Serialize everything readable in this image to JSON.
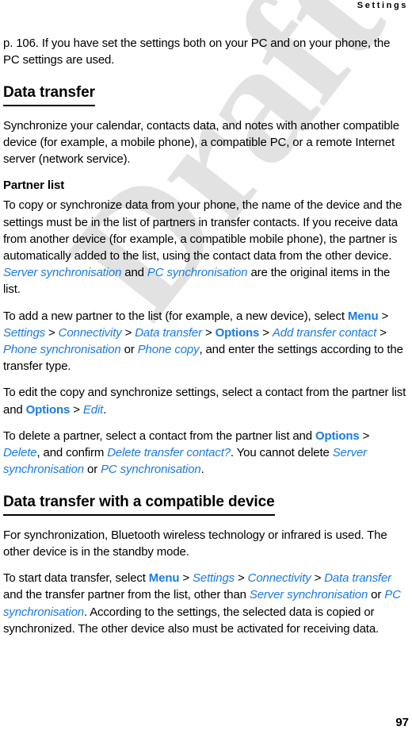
{
  "page": {
    "running_head": "Settings",
    "page_number": "97",
    "watermark": "Draft",
    "accent_color": "#1a7ae0",
    "text_color": "#000000",
    "watermark_color": "#e2e2e2"
  },
  "intro": {
    "p1_a": "p. 106. If you have set the settings both on your PC and on your phone, the PC settings are used."
  },
  "section1": {
    "heading": "Data transfer",
    "p1": "Synchronize your calendar, contacts data, and notes with another compatible device (for example, a mobile phone), a compatible PC, or a remote Internet server (network service).",
    "sub_heading": "Partner list",
    "p2_a": "To copy or synchronize data from your phone, the name of the device and the settings must be in the list of partners in transfer contacts. If you receive data from another device (for example, a compatible mobile phone), the partner is automatically added to the list, using the contact data from the other device. ",
    "p2_ref1": "Server synchronisation",
    "p2_b": " and ",
    "p2_ref2": "PC synchronisation",
    "p2_c": " are the original items in the list.",
    "p3_a": "To add a new partner to the list (for example, a new device), select ",
    "p3_key1": "Menu",
    "p3_sep1": " > ",
    "p3_ref1": "Settings",
    "p3_sep2": " > ",
    "p3_ref2": "Connectivity",
    "p3_sep3": " > ",
    "p3_ref3": "Data transfer",
    "p3_sep4": " > ",
    "p3_key2": "Options",
    "p3_sep5": " > ",
    "p3_ref4": "Add transfer contact",
    "p3_sep6": " > ",
    "p3_ref5": "Phone synchronisation",
    "p3_b": " or ",
    "p3_ref6": "Phone copy",
    "p3_c": ", and enter the settings according to the transfer type.",
    "p4_a": "To edit the copy and synchronize settings, select a contact from the partner list and ",
    "p4_key1": "Options",
    "p4_sep1": " > ",
    "p4_ref1": "Edit",
    "p4_b": ".",
    "p5_a": "To delete a partner, select a contact from the partner list and ",
    "p5_key1": "Options",
    "p5_sep1": " > ",
    "p5_ref1": "Delete",
    "p5_b": ", and confirm ",
    "p5_ref2": "Delete transfer contact?",
    "p5_c": ". You cannot delete ",
    "p5_ref3": "Server synchronisation",
    "p5_d": " or ",
    "p5_ref4": "PC synchronisation",
    "p5_e": "."
  },
  "section2": {
    "heading": "Data transfer with a compatible device",
    "p1": "For synchronization, Bluetooth wireless technology or infrared is used. The other device is in the standby mode.",
    "p2_a": "To start data transfer, select ",
    "p2_key1": "Menu",
    "p2_sep1": " > ",
    "p2_ref1": "Settings",
    "p2_sep2": " > ",
    "p2_ref2": "Connectivity",
    "p2_sep3": " > ",
    "p2_ref3": "Data transfer",
    "p2_b": " and the transfer partner from the list, other than ",
    "p2_ref4": "Server synchronisation",
    "p2_c": " or ",
    "p2_ref5": "PC synchronisation",
    "p2_d": ". According to the settings, the selected data is copied or synchronized. The other device also must be activated for receiving data."
  }
}
